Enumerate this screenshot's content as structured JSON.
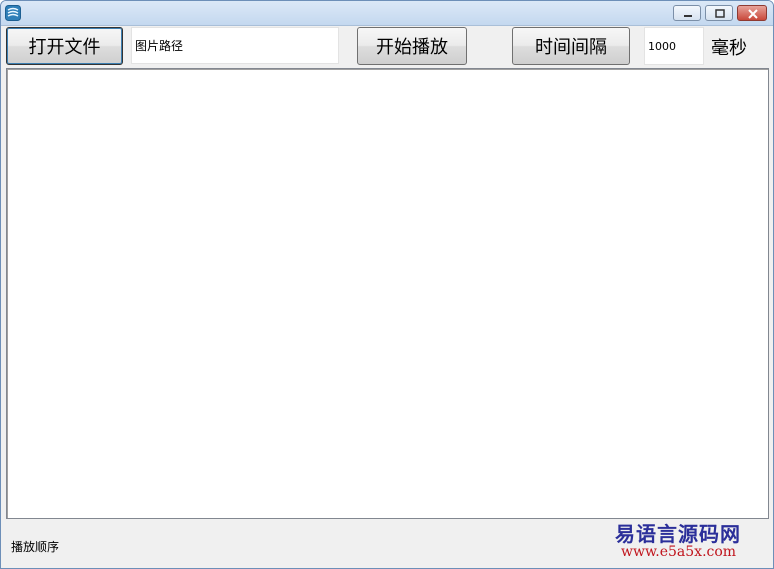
{
  "toolbar": {
    "open_file_label": "打开文件",
    "image_path_value": "图片路径",
    "start_play_label": "开始播放",
    "interval_label": "时间间隔",
    "interval_value": "1000",
    "interval_unit": "毫秒"
  },
  "status": {
    "play_order_label": "播放顺序"
  },
  "watermark": {
    "name": "易语言源码网",
    "url": "www.e5a5x.com"
  },
  "colors": {
    "titlebar": "#c4d8ef",
    "close_button": "#c9483b",
    "watermark_name": "#2b2f9a",
    "watermark_url": "#c0141c"
  }
}
